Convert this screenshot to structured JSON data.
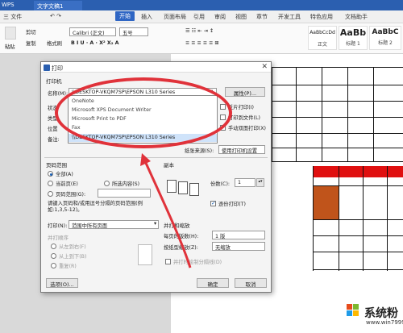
{
  "titlebar": {
    "app": "WPS",
    "doc_tab": "文字文稿1"
  },
  "menubar": {
    "file": "三 文件",
    "items": [
      "开始",
      "插入",
      "页面布局",
      "引用",
      "审阅",
      "视图",
      "章节",
      "开发工具",
      "特色应用",
      "文档助手"
    ]
  },
  "ribbon": {
    "paste": "粘贴",
    "cut": "剪切",
    "copy": "复制",
    "format_painter": "格式刷",
    "font": "Calibri (正文)",
    "size": "五号",
    "styles": [
      {
        "sample": "AaBbCcDd",
        "name": "正文"
      },
      {
        "sample": "AaBb",
        "name": "标题 1"
      },
      {
        "sample": "AaBbC",
        "name": "标题 2"
      }
    ]
  },
  "dialog": {
    "title": "打印",
    "printer_group": "打印机",
    "name_label": "名称(M):",
    "printer_value": "\\\\DESKTOP-VKQM7SP\\EPSON L310 Series",
    "properties_btn": "属性(P)...",
    "status_label": "状态",
    "type_label": "类型",
    "location_label": "位置",
    "comment_label": "备注:",
    "reverse_print": "反片打印(I)",
    "print_to_file": "打印到文件(L)",
    "manual_duplex": "手动双面打印(X)",
    "paper_source_label": "纸张来源(S):",
    "paper_source_value": "使用打印机设置",
    "page_range_group": "页码范围",
    "all": "全部(A)",
    "current_page": "当前页(E)",
    "selection": "所选内容(S)",
    "page_range": "页码范围(G):",
    "range_hint": "请键入页码和/或用逗号分隔的页码范围(例如:1,3,5-12)。",
    "print_label": "打印(N):",
    "print_value": "范围中所有页面",
    "order_group": "并打顺序",
    "left_to_right": "从左到右(F)",
    "top_to_bottom": "从上到下(B)",
    "repeat": "重复(R)",
    "copies_group": "副本",
    "copies_label": "份数(C):",
    "copies_value": "1",
    "collate": "逐份打印(T)",
    "zoom_group": "并打和缩放",
    "pages_per_sheet_label": "每页的版数(H):",
    "pages_per_sheet_value": "1 版",
    "scale_label": "按纸型缩放(Z):",
    "scale_value": "无缩放",
    "draw_borders": "并打时绘制分隔线(D)",
    "options_btn": "选项(O)...",
    "ok_btn": "确定",
    "cancel_btn": "取消"
  },
  "printer_list": [
    "OneNote",
    "Microsoft XPS Document Writer",
    "Microsoft Print to PDF",
    "Fax",
    "\\\\DESKTOP-VKQM7SP\\EPSON L310 Series"
  ],
  "watermark": {
    "text": "系统粉",
    "url": "www.win7999.com"
  },
  "colors": {
    "titlebar": "#2b5fb0",
    "annotation": "#e0323a",
    "table_red": "#e01010",
    "table_orange": "#c0541b"
  }
}
